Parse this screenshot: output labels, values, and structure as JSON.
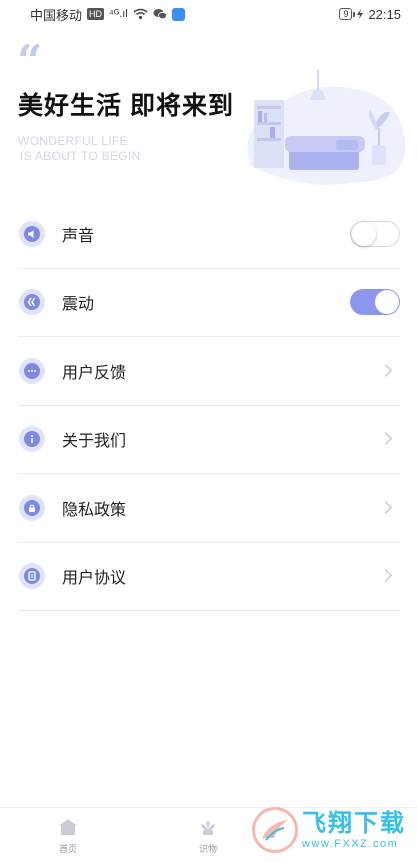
{
  "status_bar": {
    "carrier": "中国移动",
    "hd_badge": "HD",
    "signal": "⁴ᴳ.ıl",
    "battery_level": "9",
    "time": "22:15",
    "icons": [
      "hd-icon",
      "signal-icon",
      "wifi-icon",
      "wechat-icon",
      "app-notification-icon",
      "charging-icon"
    ]
  },
  "hero": {
    "quote_mark": "“",
    "title": "美好生活 即将来到",
    "subtitle_line1": "WONDERFUL LIFE",
    "subtitle_line2": "IS ABOUT TO BEGIN",
    "illustration": "living-room-illustration"
  },
  "settings": {
    "items": [
      {
        "label": "声音",
        "icon": "sound-icon",
        "control": "toggle",
        "checked": false
      },
      {
        "label": "震动",
        "icon": "vibration-icon",
        "control": "toggle",
        "checked": true
      },
      {
        "label": "用户反馈",
        "icon": "feedback-icon",
        "control": "chevron"
      },
      {
        "label": "关于我们",
        "icon": "info-icon",
        "control": "chevron"
      },
      {
        "label": "隐私政策",
        "icon": "privacy-icon",
        "control": "chevron"
      },
      {
        "label": "用户协议",
        "icon": "agreement-icon",
        "control": "chevron"
      }
    ]
  },
  "bottom_nav": {
    "items": [
      {
        "label": "首页",
        "icon": "home-icon"
      },
      {
        "label": "识物",
        "icon": "identify-icon"
      }
    ]
  },
  "watermark": {
    "brand_cn": "飞翔下载",
    "url": "www.FXXZ.com"
  },
  "colors": {
    "accent": "#8b97ec",
    "icon_bg": "#dfe3fb",
    "watermark": "#36c0e8"
  }
}
